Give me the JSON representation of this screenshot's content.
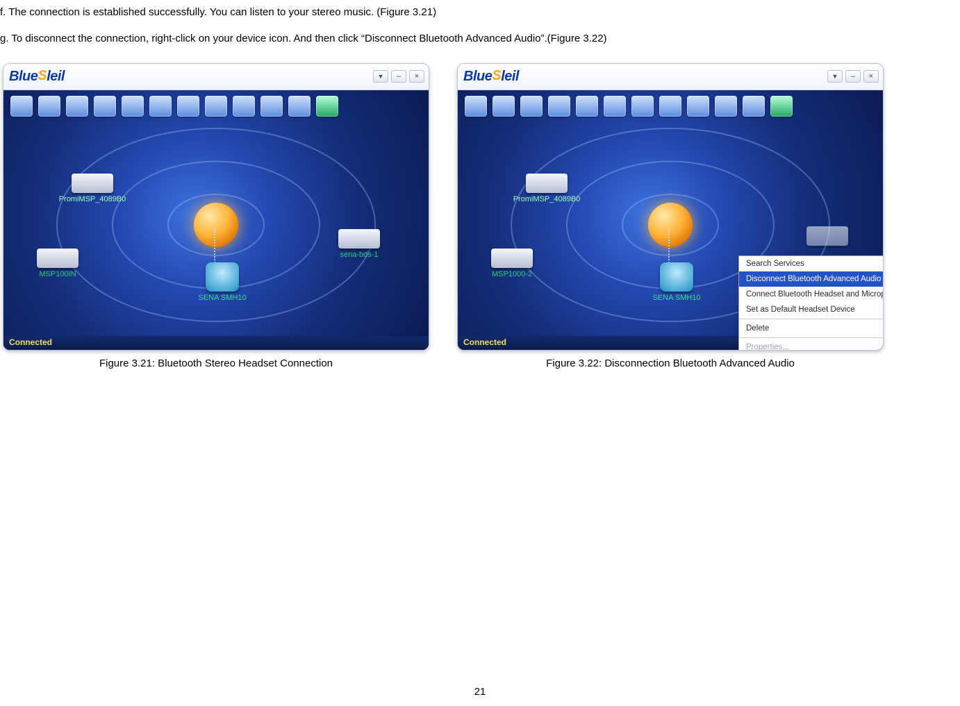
{
  "instructions": {
    "f": "f.     The connection is established successfully. You can listen to your stereo music. (Figure 3.21)",
    "g": "g.    To disconnect the connection, right-click on your device icon. And then click “Disconnect Bluetooth Advanced Audio”.(Figure 3.22)"
  },
  "brand": {
    "part1": "Blue",
    "part2": "S",
    "part3": "leil"
  },
  "window_buttons": {
    "chev": "▼",
    "min": "–",
    "close": "×"
  },
  "devices": {
    "a": "PromiMSP_4089B0",
    "b": "MSP100IN",
    "c": "sena-bds-1",
    "d": "SENA SMH10",
    "b2": "MSP1000-2"
  },
  "status": "Connected",
  "captions": {
    "left": "Figure 3.21: Bluetooth Stereo Headset Connection",
    "right": "Figure 3.22: Disconnection Bluetooth Advanced Audio"
  },
  "context_menu": {
    "search": "Search Services",
    "disconnect": "Disconnect Bluetooth Advanced Audio",
    "connect_hm": "Connect Bluetooth Headset and Microphone",
    "set_default": "Set as Default Headset Device",
    "delete": "Delete",
    "properties": "Properties..."
  },
  "page_number": "21"
}
